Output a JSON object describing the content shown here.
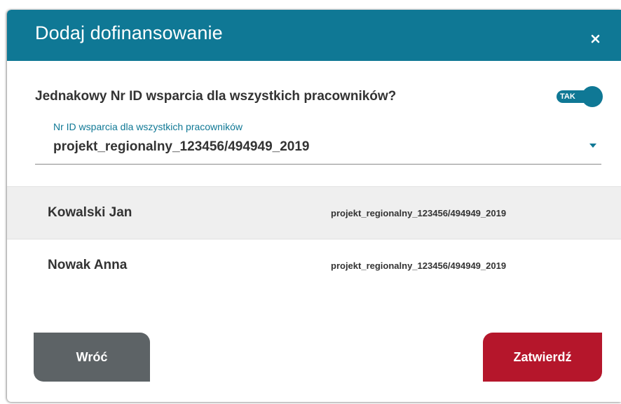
{
  "dialog": {
    "title": "Dodaj dofinansowanie",
    "close_icon": "close-icon"
  },
  "question": {
    "label": "Jednakowy Nr ID wsparcia dla wszystkich pracowników?",
    "toggle_label": "TAK",
    "toggle_on": true
  },
  "support_id_field": {
    "label": "Nr ID wsparcia dla wszystkich pracowników",
    "value": "projekt_regionalny_123456/494949_2019",
    "arrow_icon": "caret-down-icon"
  },
  "employees": [
    {
      "name": "Kowalski Jan",
      "support_id": "projekt_regionalny_123456/494949_2019"
    },
    {
      "name": "Nowak Anna",
      "support_id": "projekt_regionalny_123456/494949_2019"
    }
  ],
  "buttons": {
    "back_label": "Wróć",
    "submit_label": "Zatwierdź"
  },
  "colors": {
    "header": "#0f7895",
    "accent": "#0f7895",
    "back_button": "#5d6366",
    "submit_button": "#b5162b"
  }
}
